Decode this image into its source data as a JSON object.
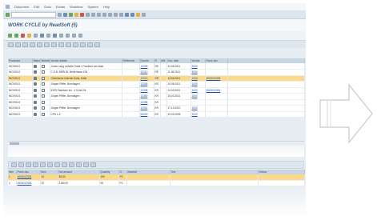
{
  "menu": {
    "items": [
      "Dokument",
      "Edit",
      "Goto",
      "Extras",
      "Workflow",
      "System",
      "Help"
    ]
  },
  "title": "WORK CYCLE by ReadSoft (5)",
  "grid1": {
    "columns": [
      "Processor",
      "Status",
      "Workflow",
      "Vendor details",
      "Reference",
      "Docnbr.",
      "Fi",
      "Mill",
      "Doc. date",
      "Vendor",
      "Purch.doc",
      ""
    ],
    "rows": [
      {
        "processor": "NICHOLS",
        "vendor": "Jones Lang LaSalle GmbH, Frankfurt am Main",
        "reference": "",
        "docnbr": "12309",
        "fi": "RE",
        "mill": "",
        "date": "10.06.2011",
        "vendor_no": "2000",
        "purch": "",
        "hl": false
      },
      {
        "processor": "NICHOLS",
        "vendor": "C.E.B. BERLIN, Berlin/Isaar 106",
        "reference": "",
        "docnbr": "12310",
        "fi": "RE",
        "mill": "",
        "date": "11.06.2011",
        "vendor_no": "3000",
        "purch": "",
        "hl": false
      },
      {
        "processor": "NICHOLS",
        "vendor": "Chemische Internet Kuhs, Halle",
        "reference": "",
        "docnbr": "12313",
        "fi": "KR",
        "mill": "",
        "date": "14.06.2011",
        "vendor_no": "1234",
        "purch": "4500012328",
        "hl": true
      },
      {
        "processor": "NICHOLS",
        "vendor": "Jürgen Pfiffer, Bornhagen",
        "reference": "",
        "docnbr": "12305",
        "fi": "KR",
        "mill": "",
        "date": "10.06.2011",
        "vendor_no": "1000",
        "purch": "",
        "hl": false
      },
      {
        "processor": "NICHOLS",
        "vendor": "IDES Fashions Inc., 4 5,lord Dr.",
        "reference": "",
        "docnbr": "12348",
        "fi": "KR",
        "mill": "",
        "date": "14.03.2011",
        "vendor_no": "1000",
        "purch": "4500012445",
        "hl": false
      },
      {
        "processor": "NICHOLS",
        "vendor": "Jürgen Pfiffer, Bornhagen",
        "reference": "",
        "docnbr": "12350",
        "fi": "KR",
        "mill": "",
        "date": "15.03.2011",
        "vendor_no": "1000",
        "purch": "",
        "hl": false
      },
      {
        "processor": "NICHOLS",
        "vendor": "",
        "reference": "",
        "docnbr": "12358",
        "fi": "KR",
        "mill": "",
        "date": "",
        "vendor_no": "",
        "purch": "",
        "hl": false
      },
      {
        "processor": "NICHOLS",
        "vendor": "Jürgen Pfiffer, Bornhagen",
        "reference": "",
        "docnbr": "12301",
        "fi": "KR",
        "mill": "",
        "date": "17.13.2010",
        "vendor_no": "1000",
        "purch": "",
        "hl": false
      },
      {
        "processor": "NICHOLS",
        "vendor": "CPS L-Z",
        "reference": "",
        "docnbr": "94009",
        "fi": "KR",
        "mill": "",
        "date": "19.03.2009",
        "vendor_no": "1000",
        "purch": "",
        "hl": false
      }
    ]
  },
  "grid2": {
    "columns": [
      "Item",
      "Purch.doc",
      "Item",
      "Net amount",
      "Quantity",
      "O.",
      "Material",
      "Text",
      "Deliver."
    ],
    "rows": [
      {
        "item": "1",
        "purch": "4500012328",
        "poitem": "10",
        "amount": "56,00",
        "qty": "100",
        "uom": "PC",
        "material": "",
        "text": "",
        "hl": true
      },
      {
        "item": "2",
        "purch": "4500012328",
        "poitem": "20",
        "amount": "2180,00",
        "qty": "50",
        "uom": "PC",
        "material": "",
        "text": "",
        "hl": false
      }
    ]
  },
  "colors": {
    "accent": "#3c5f86",
    "highlight": "#fbd98b",
    "link": "#1e4f9c"
  },
  "icons": [
    "check-icon",
    "save-icon",
    "back-icon",
    "exit-icon",
    "cancel-icon",
    "print-icon",
    "find-icon",
    "arrow-right-icon"
  ]
}
